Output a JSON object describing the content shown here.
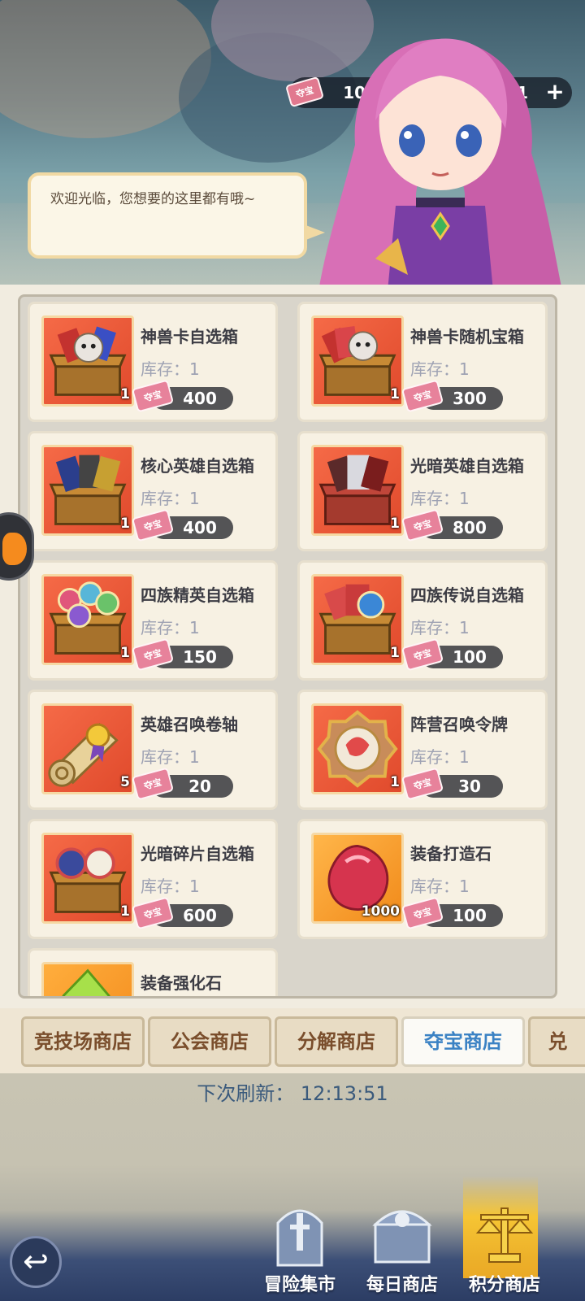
{
  "currency": {
    "ticket_icon_text": "夺宝",
    "ticket_value": "100",
    "gem_value": "31181",
    "plus": "+"
  },
  "speech": "欢迎光临，您想要的这里都有哦~",
  "items": [
    {
      "name": "神兽卡自选箱",
      "stock": "库存：1",
      "qty": "1",
      "price": "400",
      "ticket": "夺宝"
    },
    {
      "name": "神兽卡随机宝箱",
      "stock": "库存：1",
      "qty": "1",
      "price": "300",
      "ticket": "夺宝"
    },
    {
      "name": "核心英雄自选箱",
      "stock": "库存：1",
      "qty": "1",
      "price": "400",
      "ticket": "夺宝"
    },
    {
      "name": "光暗英雄自选箱",
      "stock": "库存：1",
      "qty": "1",
      "price": "800",
      "ticket": "夺宝"
    },
    {
      "name": "四族精英自选箱",
      "stock": "库存：1",
      "qty": "1",
      "price": "150",
      "ticket": "夺宝"
    },
    {
      "name": "四族传说自选箱",
      "stock": "库存：1",
      "qty": "1",
      "price": "100",
      "ticket": "夺宝"
    },
    {
      "name": "英雄召唤卷轴",
      "stock": "库存：1",
      "qty": "5",
      "price": "20",
      "ticket": "夺宝"
    },
    {
      "name": "阵营召唤令牌",
      "stock": "库存：1",
      "qty": "1",
      "price": "30",
      "ticket": "夺宝"
    },
    {
      "name": "光暗碎片自选箱",
      "stock": "库存：1",
      "qty": "1",
      "price": "600",
      "ticket": "夺宝"
    },
    {
      "name": "装备打造石",
      "stock": "库存：1",
      "qty": "1000",
      "price": "100",
      "ticket": "夺宝"
    },
    {
      "name": "装备强化石"
    }
  ],
  "tabs": [
    {
      "label": "竞技场商店"
    },
    {
      "label": "公会商店"
    },
    {
      "label": "分解商店"
    },
    {
      "label": "夺宝商店"
    },
    {
      "label": "兑"
    }
  ],
  "refresh": "下次刷新：  12:13:51",
  "nav": {
    "back": "↩",
    "items": [
      {
        "label": "冒险集市",
        "icon": "sword-shrine-icon"
      },
      {
        "label": "每日商店",
        "icon": "treasure-chest-icon"
      },
      {
        "label": "积分商店",
        "icon": "scales-icon"
      }
    ]
  }
}
